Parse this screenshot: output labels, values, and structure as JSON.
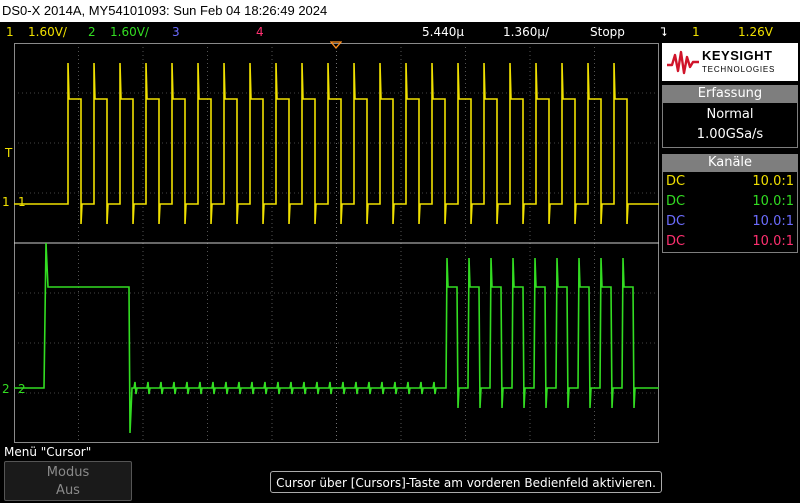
{
  "title": "DS0-X 2014A, MY54101093: Sun Feb 04 18:26:49 2024",
  "status": {
    "ch1_num": "1",
    "ch1_scale": "1.60V/",
    "ch2_num": "2",
    "ch2_scale": "1.60V/",
    "ch3_num": "3",
    "ch4_num": "4",
    "time_pos": "5.440&#x0024;",
    "time_pos_text": "5.440µ",
    "time_div_text": "1.360µ/",
    "run_state": "Stopp",
    "trig_src": "1",
    "trig_level": "1.26V"
  },
  "colors": {
    "ch1": "#f0e000",
    "ch2": "#33dd22",
    "ch3": "#6c6cff",
    "ch4": "#ff3070",
    "grid": "#8a8a8a"
  },
  "brand": {
    "name": "KEYSIGHT",
    "sub": "TECHNOLOGIES"
  },
  "acquisition": {
    "header": "Erfassung",
    "mode": "Normal",
    "rate": "1.00GSa/s"
  },
  "channels": {
    "header": "Kanäle",
    "rows": [
      {
        "coupling": "DC",
        "probe": "10.0:1"
      },
      {
        "coupling": "DC",
        "probe": "10.0:1"
      },
      {
        "coupling": "DC",
        "probe": "10.0:1"
      },
      {
        "coupling": "DC",
        "probe": "10.0:1"
      }
    ]
  },
  "markers": {
    "ch1": "1",
    "ch2": "2",
    "trigger": "T"
  },
  "menu": {
    "label": "Menü \"Cursor\"",
    "softkey_line1": "Modus",
    "softkey_line2": "Aus"
  },
  "hint": "Cursor über [Cursors]-Taste am vorderen Bedienfeld aktivieren."
}
